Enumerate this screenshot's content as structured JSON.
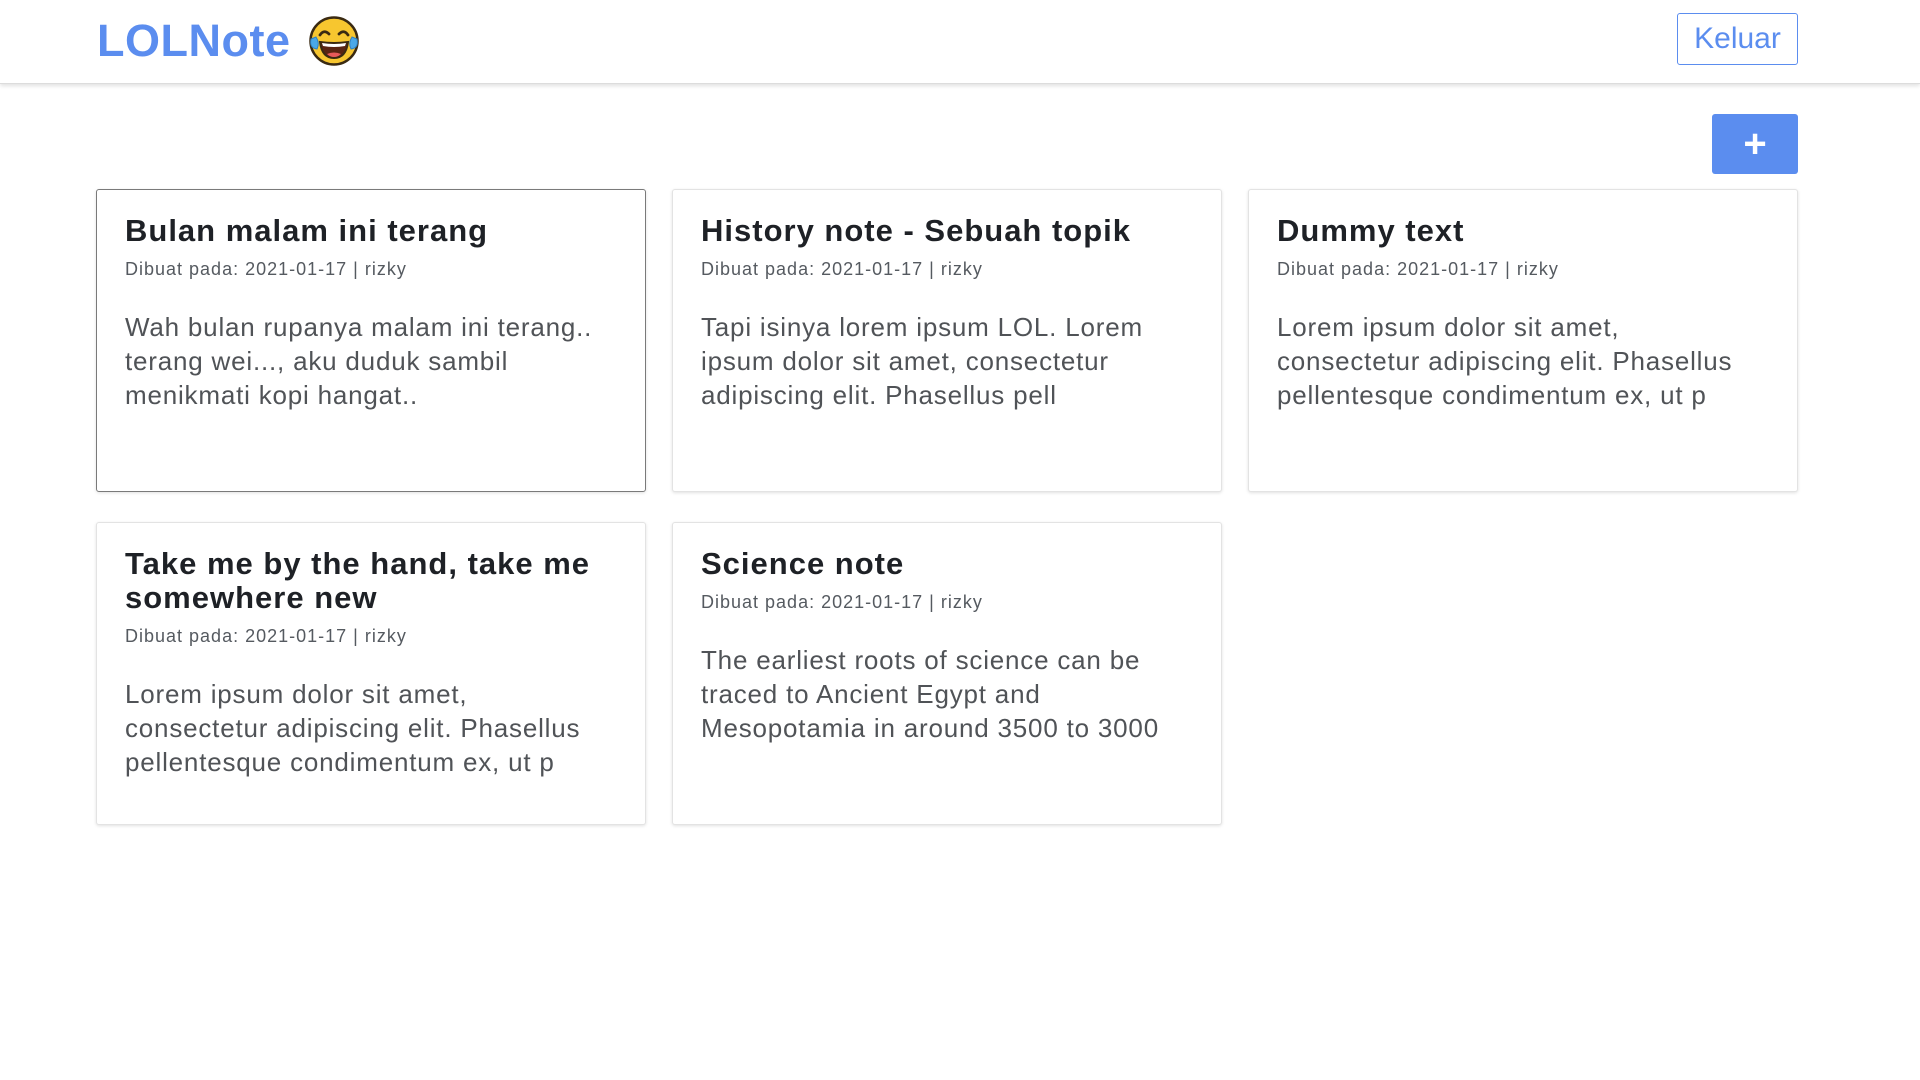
{
  "app": {
    "brand": "LOLNote",
    "brand_emoji": "face-with-tears-of-joy-emoji"
  },
  "navbar": {
    "logout_label": "Keluar"
  },
  "toolbar": {
    "add_label": "+"
  },
  "colors": {
    "accent": "#5b8def",
    "emoji_yellow": "#f7c62f"
  },
  "notes": [
    {
      "title": "Bulan malam ini terang",
      "meta": "Dibuat pada: 2021-01-17 | rizky",
      "body": "Wah bulan rupanya malam ini terang.. terang wei..., aku duduk sambil menikmati kopi hangat.."
    },
    {
      "title": "History note - Sebuah topik",
      "meta": "Dibuat pada: 2021-01-17 | rizky",
      "body": "Tapi isinya lorem ipsum LOL. Lorem ipsum dolor sit amet, consectetur adipiscing elit. Phasellus pell"
    },
    {
      "title": "Dummy text",
      "meta": "Dibuat pada: 2021-01-17 | rizky",
      "body": "Lorem ipsum dolor sit amet, consectetur adipiscing elit. Phasellus pellentesque condimentum ex, ut p"
    },
    {
      "title": "Take me by the hand, take me somewhere new",
      "meta": "Dibuat pada: 2021-01-17 | rizky",
      "body": "Lorem ipsum dolor sit amet, consectetur adipiscing elit. Phasellus pellentesque condimentum ex, ut p"
    },
    {
      "title": "Science note",
      "meta": "Dibuat pada: 2021-01-17 | rizky",
      "body": "The earliest roots of science can be traced to Ancient Egypt and Mesopotamia in around 3500 to 3000"
    }
  ]
}
